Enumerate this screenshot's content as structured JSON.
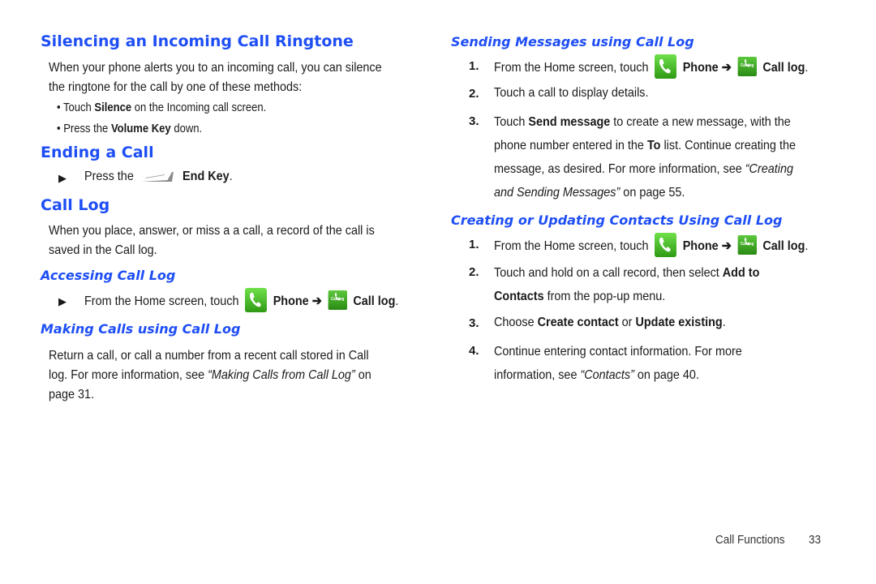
{
  "left": {
    "silencing": {
      "title": "Silencing an Incoming Call Ringtone",
      "intro_line1": "When your phone alerts you to an incoming call, you can silence",
      "intro_line2": "the ringtone for the call by one of these methods:",
      "bullets": [
        {
          "pre": "• Touch ",
          "bold": "Silence",
          "post": " on the Incoming call screen."
        },
        {
          "pre": "• Press the ",
          "bold": "Volume Key",
          "post": " down."
        }
      ]
    },
    "ending": {
      "title": "Ending a Call",
      "step_pre": "Press the",
      "step_bold": "End Key",
      "step_post": ".",
      "icon": "end-key-icon"
    },
    "call_log": {
      "title": "Call Log",
      "line1": "When you place, answer, or miss a a call, a record of the call is",
      "line2": "saved in the Call log."
    },
    "accessing": {
      "title": "Accessing Call Log",
      "pre": "From the Home screen, touch",
      "phone": "Phone",
      "arrow": "➔",
      "log": "Call log",
      "post": "."
    },
    "making": {
      "title": "Making Calls using Call Log",
      "line1": "Return a call, or call a number from a recent call stored in Call",
      "line2_pre": "log. For more information, see ",
      "line2_ref": "“Making Calls from Call Log”",
      "line2_post": " on",
      "line3": "page 31."
    }
  },
  "right": {
    "sending": {
      "title": "Sending Messages using Call Log",
      "steps": [
        {
          "num": "1.",
          "pre": "From the Home screen, touch",
          "phone": "Phone",
          "arrow": "➔",
          "log": "Call log",
          "post": "."
        },
        {
          "num": "2.",
          "text": "Touch a call to display details."
        },
        {
          "num": "3.",
          "l1_pre": "Touch ",
          "l1_bold": "Send message",
          "l1_post": " to create a new message, with the",
          "l2_pre": "phone number entered in the ",
          "l2_bold": "To",
          "l2_post": " list. Continue creating the",
          "l3_pre": "message, as desired. For more information, see ",
          "l3_ref": "“Creating",
          "l4_ref": "and Sending Messages”",
          "l4_post": " on page 55."
        }
      ]
    },
    "creating": {
      "title": "Creating or Updating Contacts Using Call Log",
      "steps": [
        {
          "num": "1.",
          "pre": "From the Home screen, touch",
          "phone": "Phone",
          "arrow": "➔",
          "log": "Call log",
          "post": "."
        },
        {
          "num": "2.",
          "l1_pre": "Touch and hold on a call record, then select ",
          "l1_bold": "Add to",
          "l2_bold": "Contacts",
          "l2_post": " from the pop-up menu."
        },
        {
          "num": "3.",
          "pre": "Choose ",
          "b1": "Create contact",
          "mid": " or ",
          "b2": "Update existing",
          "post": "."
        },
        {
          "num": "4.",
          "l1": "Continue entering contact information. For more",
          "l2_pre": "information, see ",
          "l2_ref": "“Contacts”",
          "l2_post": " on page 40."
        }
      ]
    }
  },
  "icons": {
    "phone_tile_label": "Call log",
    "bullet_arrow": "▶"
  },
  "footer": {
    "section": "Call Functions",
    "page": "33"
  },
  "colors": {
    "heading": "#1e4ef5",
    "icon_green": "#3cb41e"
  }
}
